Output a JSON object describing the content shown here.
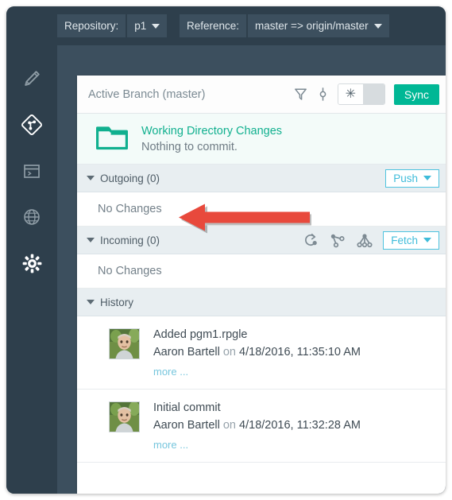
{
  "toolbar": {
    "repository": {
      "label": "Repository:",
      "value": "p1",
      "caret_icon": "chevron-down-icon"
    },
    "reference": {
      "label": "Reference:",
      "value": "master => origin/master",
      "caret_icon": "chevron-down-icon"
    }
  },
  "sidebar": {
    "items": [
      {
        "name": "edit",
        "icon": "pencil-icon"
      },
      {
        "name": "git",
        "icon": "git-logo-icon"
      },
      {
        "name": "console",
        "icon": "terminal-window-icon"
      },
      {
        "name": "web",
        "icon": "globe-icon"
      },
      {
        "name": "settings",
        "icon": "gear-icon"
      }
    ]
  },
  "card": {
    "header": {
      "title": "Active Branch (master)",
      "filter_icon": "filter-funnel-icon",
      "branch_icon": "commit-node-icon",
      "toggle": {
        "on_glyph": "✳",
        "on_icon": "asterisk-icon"
      },
      "sync_label": "Sync"
    },
    "working_directory": {
      "icon": "folder-icon",
      "title": "Working Directory Changes",
      "subtitle": "Nothing to commit."
    },
    "outgoing": {
      "title": "Outgoing (0)",
      "collapse_icon": "triangle-down-icon",
      "button_label": "Push",
      "button_caret_icon": "chevron-down-icon",
      "empty_text": "No Changes"
    },
    "incoming": {
      "title": "Incoming (0)",
      "collapse_icon": "triangle-down-icon",
      "icons": [
        "rebase-icon",
        "branch-icon",
        "merge-icon"
      ],
      "button_label": "Fetch",
      "button_caret_icon": "chevron-down-icon",
      "empty_text": "No Changes"
    },
    "history": {
      "title": "History",
      "collapse_icon": "triangle-down-icon",
      "more_label": "more ...",
      "on_word": "on",
      "commits": [
        {
          "message": "Added pgm1.rpgle",
          "author": "Aaron Bartell",
          "timestamp": "4/18/2016, 11:35:10 AM"
        },
        {
          "message": "Initial commit",
          "author": "Aaron Bartell",
          "timestamp": "4/18/2016, 11:32:28 AM"
        }
      ]
    }
  },
  "annotation": {
    "arrow_icon": "left-arrow-annotation",
    "color": "#e8493c"
  },
  "colors": {
    "window_chrome": "#2e3f4c",
    "panel_backdrop": "#3c4f5e",
    "accent_teal": "#00b795",
    "accent_cyan": "#3ebcda",
    "section_header_bg": "#e8eef1",
    "working_dir_bg": "#f3fbf9"
  }
}
